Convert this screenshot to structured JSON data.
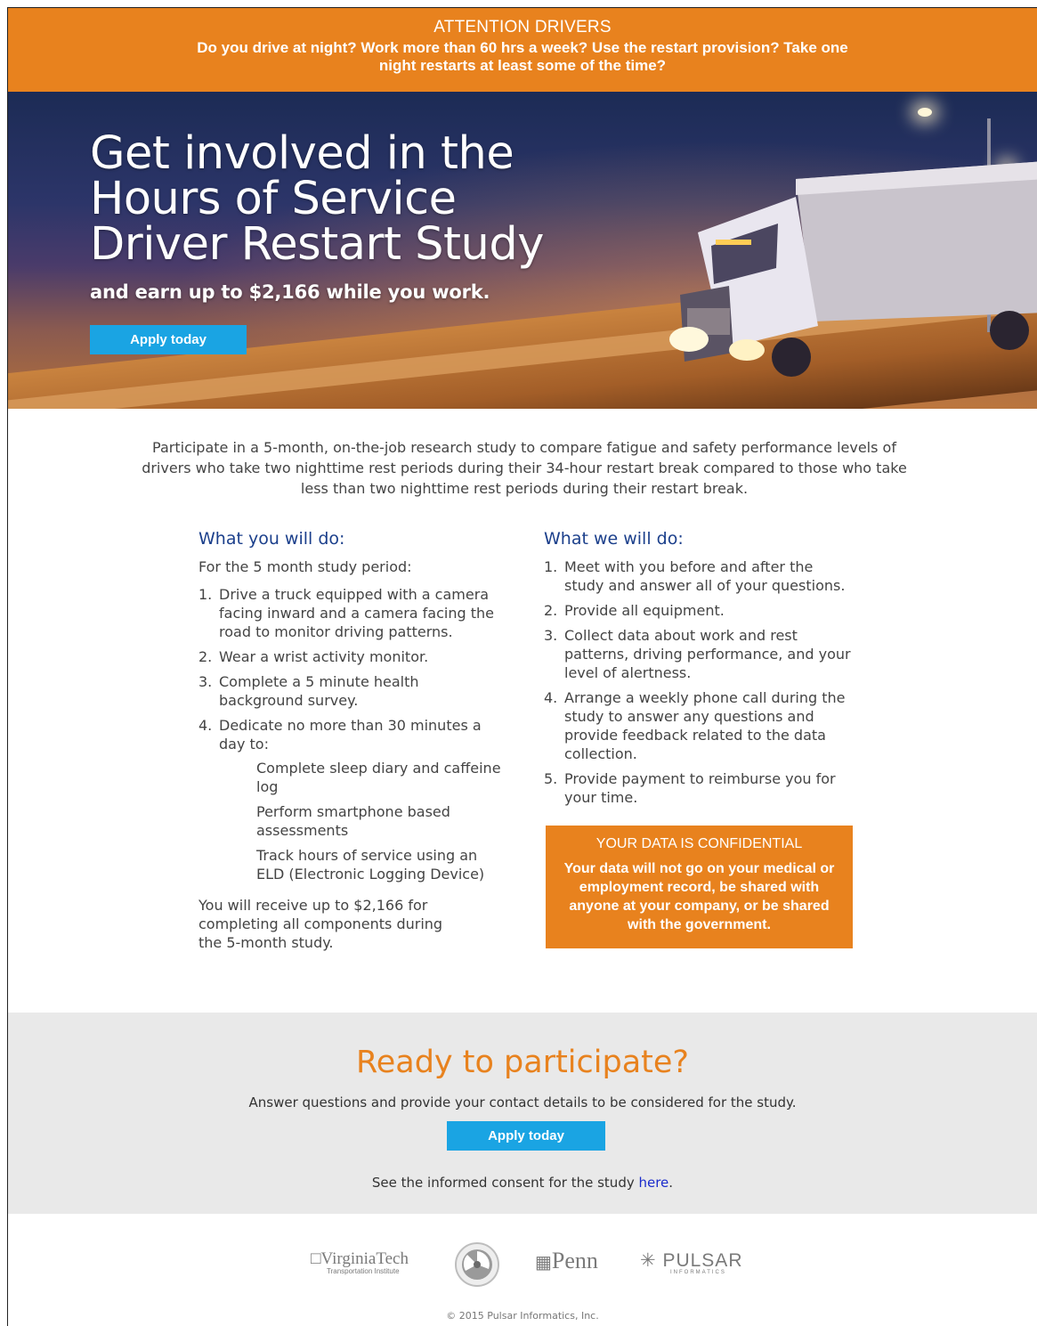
{
  "banner": {
    "title": "ATTENTION DRIVERS",
    "text": "Do you drive at night? Work more than 60 hrs a week? Use the restart provision? Take one night restarts at least some of the time?"
  },
  "hero": {
    "headline_1": "Get involved in the",
    "headline_2": "Hours of Service",
    "headline_3": "Driver Restart Study",
    "subhead": "and earn up to $2,166 while you work.",
    "button": "Apply today"
  },
  "intro": "Participate in a 5-month, on-the-job research study to compare fatigue and safety performance levels of drivers who take two nighttime rest periods during their 34-hour restart break compared to those who take less than two nighttime rest periods during their restart break.",
  "you": {
    "heading": "What you will do:",
    "lead": "For the 5 month study period:",
    "items": [
      {
        "num": "1.",
        "text": "Drive a truck equipped with a camera facing inward and a camera facing the road to monitor driving patterns."
      },
      {
        "num": "2.",
        "text": "Wear a wrist activity monitor."
      },
      {
        "num": "3.",
        "text": "Complete a 5 minute health background survey."
      },
      {
        "num": "4.",
        "text": "Dedicate no more than 30 minutes a day to:"
      }
    ],
    "subitems": [
      "Complete sleep diary and caffeine log",
      "Perform smartphone based assessments",
      "Track hours of service using an ELD (Electronic Logging Device)"
    ],
    "footer": "You will receive up to $2,166 for completing all components during the 5-month study."
  },
  "we": {
    "heading": "What we will do:",
    "items": [
      {
        "num": "1.",
        "text": "Meet with you before and after the study and answer all of your questions."
      },
      {
        "num": "2.",
        "text": "Provide all equipment."
      },
      {
        "num": "3.",
        "text": "Collect data about work and rest patterns, driving performance, and your level of alertness."
      },
      {
        "num": "4.",
        "text": "Arrange a weekly phone call during the study to answer any questions and provide feedback related to the data collection."
      },
      {
        "num": "5.",
        "text": "Provide payment to reimburse you for your time."
      }
    ]
  },
  "confidential": {
    "title": "YOUR DATA IS CONFIDENTIAL",
    "text": "Your data will not go on your medical or employment record, be shared with anyone at your company, or be shared with the government."
  },
  "ready": {
    "heading": "Ready to participate?",
    "text": "Answer questions and provide your contact details to be considered for the study.",
    "button": "Apply today",
    "consent_prefix": "See the informed consent for the study ",
    "consent_link": "here",
    "consent_suffix": "."
  },
  "logos": {
    "vt": "VirginiaTech",
    "vt_sub": "Transportation Institute",
    "penn": "Penn",
    "pulsar": "PULSAR",
    "pulsar_sub": "INFORMATICS"
  },
  "copyright": "© 2015 Pulsar Informatics, Inc.",
  "colors": {
    "accent_orange": "#e8821e",
    "button_blue": "#1aa4e3",
    "heading_blue": "#1b3f8b",
    "section_gray": "#e9e9e9"
  }
}
